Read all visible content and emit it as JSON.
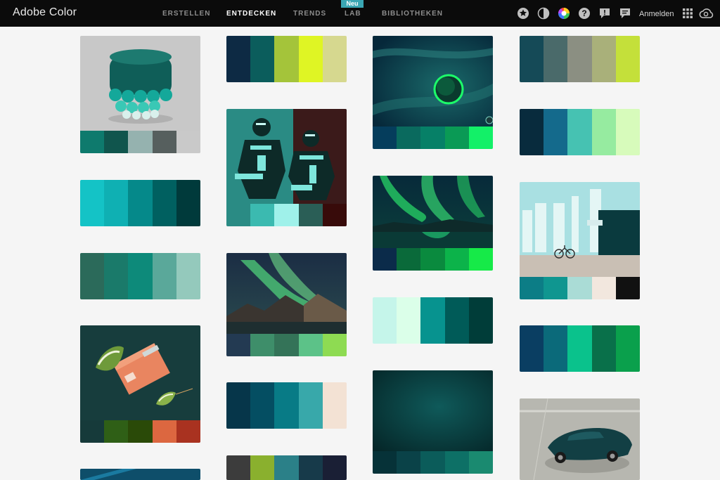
{
  "header": {
    "brand": "Adobe Color",
    "nav": [
      "ERSTELLEN",
      "ENTDECKEN",
      "TRENDS",
      "LAB",
      "BIBLIOTHEKEN"
    ],
    "active": "ENTDECKEN",
    "badge": "Neu",
    "signin": "Anmelden",
    "icons": [
      "star-icon",
      "contrast-icon",
      "color-wheel-icon",
      "help-icon",
      "feedback-icon",
      "chat-icon",
      "apps-grid-icon",
      "creative-cloud-icon"
    ]
  },
  "colors": {
    "topbar": "#0b0b0b",
    "page_bg": "#f5f5f5",
    "accent": "#3aa6b3"
  },
  "cards": [
    {
      "kind": "image",
      "image": "cake-stand-photo",
      "colors": [
        "#0e7a6d",
        "#10554d",
        "#95b2af",
        "#565f5e",
        "#c9c9c9"
      ]
    },
    {
      "kind": "palette",
      "colors": [
        "#14c3c6",
        "#0fb0b3",
        "#05898a",
        "#006060",
        "#003a3b"
      ]
    },
    {
      "kind": "palette",
      "colors": [
        "#2b6a5a",
        "#1a7a6a",
        "#0d8a7a",
        "#5aa89a",
        "#94c9bc"
      ]
    },
    {
      "kind": "image",
      "image": "leaf-and-salt-block-photo",
      "colors": [
        "#163a3a",
        "#2f5f16",
        "#2a4a08",
        "#dc6740",
        "#a93220"
      ]
    },
    {
      "kind": "image",
      "image": "teal-thumbnail-partial",
      "colors": [
        "#0e4e6a",
        "#0e4e6a",
        "#0e4e6a",
        "#0e4e6a",
        "#0e4e6a"
      ]
    },
    {
      "kind": "palette",
      "colors": [
        "#0d2a44",
        "#0b5d5c",
        "#a4c43a",
        "#dff524",
        "#d6d88f"
      ]
    },
    {
      "kind": "image",
      "image": "illustration-two-men",
      "colors": [
        "#2a8b84",
        "#3bbab0",
        "#9ff1ea",
        "#2a5e56",
        "#380b0a"
      ]
    },
    {
      "kind": "image",
      "image": "aurora-mountain-photo",
      "colors": [
        "#233a52",
        "#3e8e6a",
        "#347358",
        "#5cc288",
        "#8edb52"
      ]
    },
    {
      "kind": "palette",
      "colors": [
        "#06364a",
        "#044e62",
        "#087b86",
        "#38a8aa",
        "#f3e2d4"
      ]
    },
    {
      "kind": "palette",
      "colors": [
        "#3c3c3c",
        "#8ab02e",
        "#2b8088",
        "#173a4a",
        "#1a1f35"
      ]
    },
    {
      "kind": "image",
      "image": "space-planet-artwork",
      "colors": [
        "#053d5c",
        "#0a6a5e",
        "#068067",
        "#0a9a55",
        "#13f068"
      ]
    },
    {
      "kind": "image",
      "image": "aurora-lake-photo",
      "colors": [
        "#0b2b4a",
        "#0a6a3a",
        "#0a8a3e",
        "#0cb34a",
        "#16ea48"
      ]
    },
    {
      "kind": "palette",
      "colors": [
        "#c5f5ea",
        "#dbffe9",
        "#07938f",
        "#005b58",
        "#003d39"
      ]
    },
    {
      "kind": "image",
      "image": "dark-teal-texture",
      "colors": [
        "#063238",
        "#0a4248",
        "#0b5c5a",
        "#0d7066",
        "#1a8a70"
      ]
    },
    {
      "kind": "palette",
      "colors": [
        "#154a57",
        "#4a6a6a",
        "#8b8f82",
        "#a9b07a",
        "#c4e03a"
      ]
    },
    {
      "kind": "palette",
      "colors": [
        "#082b3d",
        "#146a8c",
        "#46c2b2",
        "#96eba0",
        "#d7fbbb"
      ]
    },
    {
      "kind": "image",
      "image": "wall-mural-bicycle-photo",
      "colors": [
        "#0c7d86",
        "#0f9690",
        "#aadcd6",
        "#f2e7de",
        "#111111"
      ]
    },
    {
      "kind": "palette",
      "colors": [
        "#0a3e62",
        "#0b6a7a",
        "#0ac28c",
        "#09704a",
        "#0aa04c"
      ]
    },
    {
      "kind": "image",
      "image": "convertible-car-photo",
      "colors": [
        "#b7b7b0",
        "#b7b7b0",
        "#b7b7b0",
        "#b7b7b0",
        "#b7b7b0"
      ]
    }
  ]
}
